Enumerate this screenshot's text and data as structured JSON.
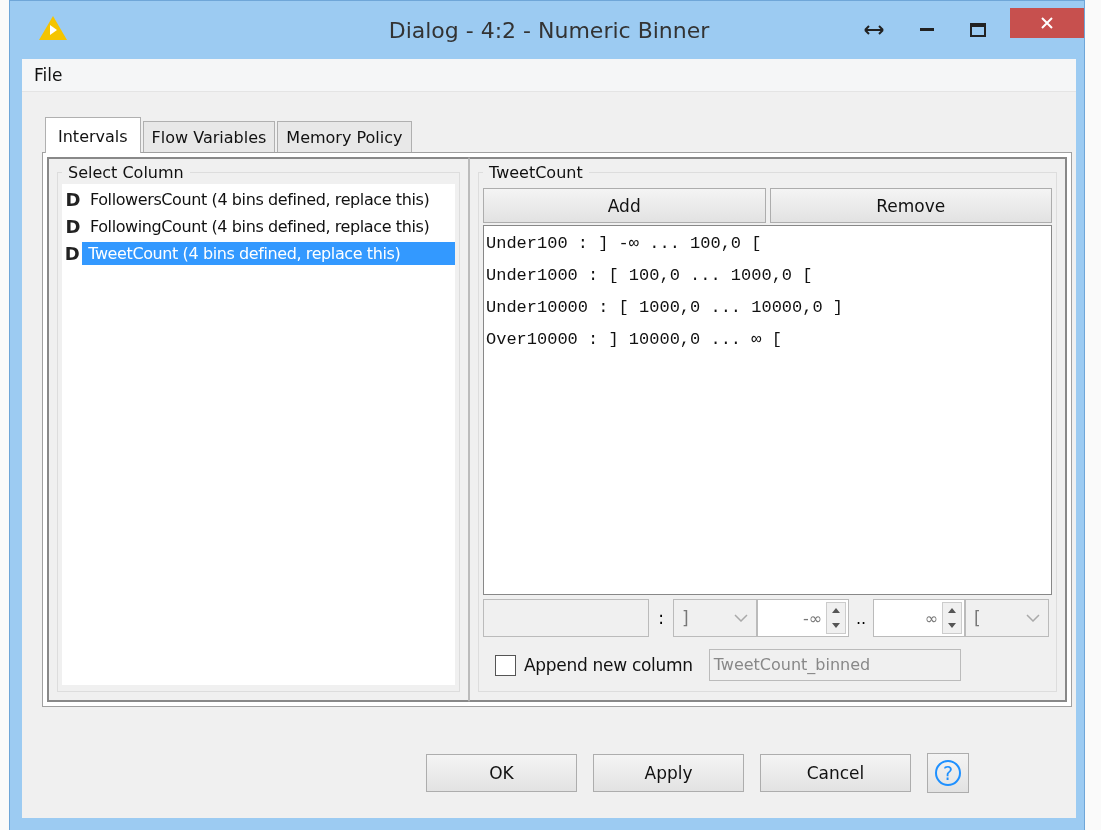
{
  "window": {
    "title": "Dialog - 4:2 - Numeric Binner"
  },
  "menu": [
    "File"
  ],
  "tabs": [
    {
      "label": "Intervals",
      "selected": true
    },
    {
      "label": "Flow Variables",
      "selected": false
    },
    {
      "label": "Memory Policy",
      "selected": false
    }
  ],
  "select_column": {
    "title": "Select Column",
    "items": [
      {
        "type_icon": "D",
        "label": "FollowersCount (4 bins defined, replace this)",
        "selected": false
      },
      {
        "type_icon": "D",
        "label": "FollowingCount (4 bins defined, replace this)",
        "selected": false
      },
      {
        "type_icon": "D",
        "label": "TweetCount (4 bins defined, replace this)",
        "selected": true
      }
    ]
  },
  "bins_panel": {
    "title": "TweetCount",
    "buttons": [
      "Add",
      "Remove"
    ],
    "bins": [
      "Under100 : ] -∞ ... 100,0 [",
      "Under1000 : [ 100,0 ... 1000,0 [",
      "Under10000 : [ 1000,0 ... 10000,0 ]",
      "Over10000 : ] 10000,0 ... ∞ ["
    ],
    "editor": {
      "colon": ":",
      "left_bracket": "]",
      "lower": "-∞",
      "range_sep": "..",
      "upper": "∞",
      "right_bracket": "["
    },
    "append": {
      "label": "Append new column",
      "checked": false,
      "value": "TweetCount_binned"
    }
  },
  "buttons": [
    "OK",
    "Apply",
    "Cancel"
  ],
  "help": "?"
}
